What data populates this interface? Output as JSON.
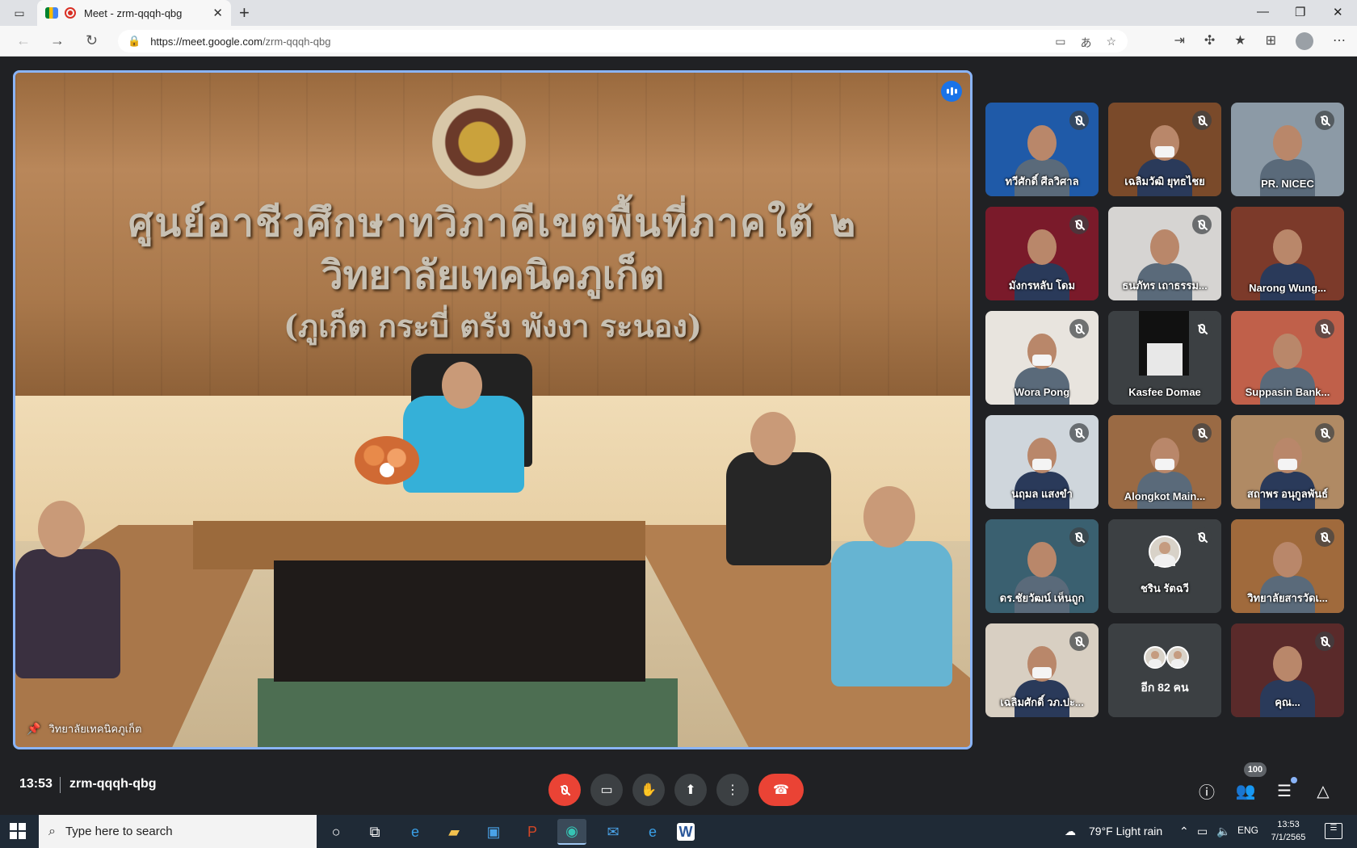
{
  "browser": {
    "tab_title": "Meet - zrm-qqqh-qbg",
    "tab_close": "✕",
    "new_tab": "+",
    "url_host": "https://meet.google.com",
    "url_path": "/zrm-qqqh-qbg",
    "window_min": "—",
    "window_max": "❐",
    "window_close": "✕"
  },
  "main_video": {
    "participant_name": "วิทยาลัยเทคนิคภูเก็ต",
    "wall_sign_line1": "ศูนย์อาชีวศึกษาทวิภาคีเขตพื้นที่ภาคใต้ ๒",
    "wall_sign_line2": "วิทยาลัยเทคนิคภูเก็ต",
    "wall_sign_line3": "(ภูเก็ต กระบี่ ตรัง พังงา ระนอง)"
  },
  "tiles": [
    {
      "name": "ทวีศักดิ์ ศีลวิศาล",
      "muted": true,
      "bg": "#1f5aa8"
    },
    {
      "name": "เฉลิมวัฒิ ยุทธไชย",
      "muted": true,
      "bg": "#7a4a2a"
    },
    {
      "name": "PR. NICEC",
      "muted": true,
      "bg": "#8c9aa6"
    },
    {
      "name": "มังกรหลับ โดม",
      "muted": true,
      "bg": "#7a1a2a"
    },
    {
      "name": "ธนภัทร เถาธรรม...",
      "muted": true,
      "bg": "#d6d4d2"
    },
    {
      "name": "Narong Wung...",
      "muted": false,
      "bg": "#7c3a2a"
    },
    {
      "name": "Wora Pong",
      "muted": true,
      "bg": "#e8e4de"
    },
    {
      "name": "Kasfee Domae",
      "muted": true,
      "bg": "#3c4043"
    },
    {
      "name": "Suppasin Bank...",
      "muted": true,
      "bg": "#c0604a"
    },
    {
      "name": "นฤมล แสงขำ",
      "muted": true,
      "bg": "#cfd6dc"
    },
    {
      "name": "Alongkot Main...",
      "muted": true,
      "bg": "#9a6a44"
    },
    {
      "name": "สถาพร อนุกูลพันธ์",
      "muted": true,
      "bg": "#b08a64"
    },
    {
      "name": "ดร.ชัยวัฒน์ เห็นถูก",
      "muted": true,
      "bg": "#3a6070"
    },
    {
      "name": "ชริน รัตฉวี",
      "muted": true,
      "bg": "#3c4043"
    },
    {
      "name": "วิทยาลัยสารวัดเ...",
      "muted": true,
      "bg": "#a06a3c"
    },
    {
      "name": "เฉลิมศักดิ์ วภ.ปะ...",
      "muted": true,
      "bg": "#d8cfc2"
    },
    {
      "name": "อีก 82 คน",
      "muted": false,
      "bg": "#3c4043"
    },
    {
      "name": "คุณ...",
      "muted": true,
      "bg": "#5a2a2a"
    }
  ],
  "controls": {
    "time": "13:53",
    "meeting_code": "zrm-qqqh-qbg",
    "participant_count": "100"
  },
  "taskbar": {
    "search_placeholder": "Type here to search",
    "weather": "79°F  Light rain",
    "lang": "ENG",
    "time": "13:53",
    "date": "7/1/2565"
  },
  "icons": {
    "mic": "mic-off-icon",
    "camera": "camera-icon",
    "hand": "raise-hand-icon",
    "present": "present-icon",
    "more": "more-icon",
    "end": "end-call-icon",
    "info": "info-icon",
    "people": "people-icon",
    "chat": "chat-icon",
    "activities": "activities-icon"
  },
  "colors": {
    "accent": "#8ab4f8",
    "end_call": "#ea4335",
    "speaking": "#1a73e8"
  }
}
